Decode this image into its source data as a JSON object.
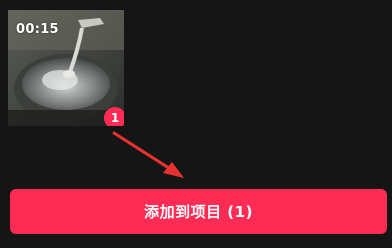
{
  "media_item": {
    "duration": "00:15",
    "selection_index": "1",
    "thumbnail_icon": "video-thumbnail"
  },
  "annotation": {
    "icon": "red-arrow-icon",
    "color": "#e8322f"
  },
  "add_button": {
    "label": "添加到项目 (1)",
    "color": "#fe2c55"
  }
}
